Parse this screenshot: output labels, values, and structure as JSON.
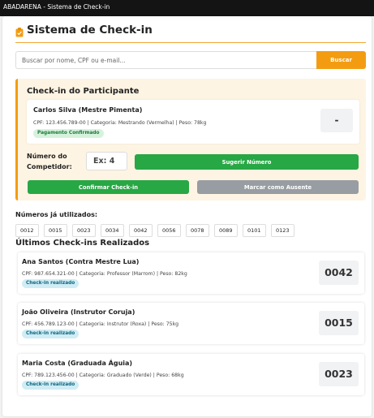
{
  "window": {
    "title": "ABADARENA - Sistema de Check-in"
  },
  "header": {
    "title": "Sistema de Check-in",
    "icon": "clipboard-check-icon"
  },
  "search": {
    "placeholder": "Buscar por nome, CPF ou e-mail...",
    "value": "",
    "button_label": "Buscar"
  },
  "checkin": {
    "title": "Check-in do Participante",
    "participant": {
      "name": "Carlos Silva (Mestre Pimenta)",
      "details": "CPF: 123.456.789-00 | Categoria: Mestrando (Vermelha) | Peso: 78kg",
      "status_badge": "Pagamento Confirmado",
      "number": "-"
    },
    "competitor_label": "Número do Competidor:",
    "competitor_placeholder": "Ex: 4",
    "suggest_button": "Sugerir Número",
    "confirm_button": "Confirmar Check-in",
    "absent_button": "Marcar como Ausente"
  },
  "used_numbers": {
    "title": "Números já utilizados:",
    "items": [
      "0012",
      "0015",
      "0023",
      "0034",
      "0042",
      "0056",
      "0078",
      "0089",
      "0101",
      "0123"
    ]
  },
  "recent": {
    "title": "Últimos Check-ins Realizados",
    "items": [
      {
        "name": "Ana Santos (Contra Mestre Lua)",
        "details": "CPF: 987.654.321-00 | Categoria: Professor (Marrom) | Peso: 82kg",
        "badge": "Check-in realizado",
        "number": "0042"
      },
      {
        "name": "João Oliveira (Instrutor Coruja)",
        "details": "CPF: 456.789.123-00 | Categoria: Instrutor (Roxa) | Peso: 75kg",
        "badge": "Check-in realizado",
        "number": "0015"
      },
      {
        "name": "Maria Costa (Graduada Águia)",
        "details": "CPF: 789.123.456-00 | Categoria: Graduado (Verde) | Peso: 68kg",
        "badge": "Check-in realizado",
        "number": "0023"
      }
    ]
  },
  "colors": {
    "accent": "#f39c12",
    "success": "#28a745",
    "muted": "#979da2",
    "paid_badge": "#d6f2dd",
    "done_badge": "#d0ecf4"
  }
}
